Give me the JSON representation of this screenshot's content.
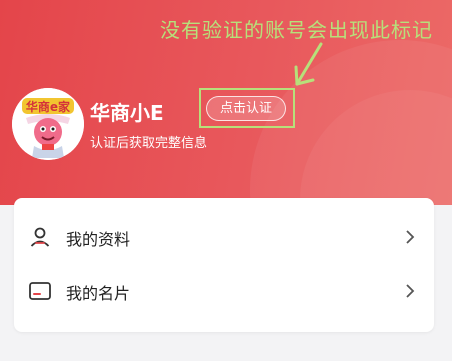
{
  "annotation": {
    "note": "没有验证的账号会出现此标记",
    "color": "#b7e07a"
  },
  "profile": {
    "name": "华商小E",
    "verify_button": "点击认证",
    "subtitle": "认证后获取完整信息",
    "avatar_icon": "mascot-avatar-icon",
    "avatar_logo_text": "华商e家"
  },
  "menu": {
    "items": [
      {
        "label": "我的资料",
        "icon": "person-icon"
      },
      {
        "label": "我的名片",
        "icon": "card-icon"
      }
    ]
  },
  "theme": {
    "header_red": "#e4454a",
    "accent_green": "#b7e07a"
  }
}
